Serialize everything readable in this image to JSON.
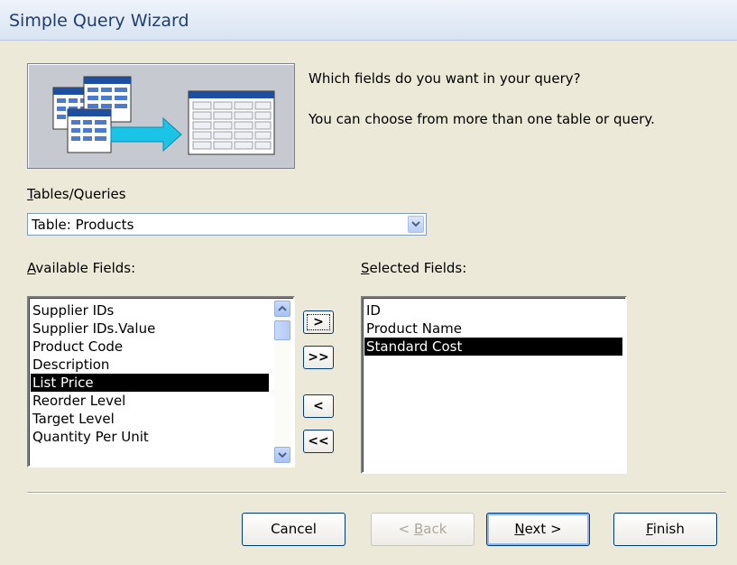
{
  "window": {
    "title": "Simple Query Wizard"
  },
  "prompt": {
    "line1": "Which fields do you want in your query?",
    "line2": "You can choose from more than one table or query."
  },
  "tables": {
    "label_first": "T",
    "label_rest": "ables/Queries",
    "selected": "Table: Products"
  },
  "available": {
    "label_first": "A",
    "label_rest": "vailable Fields:",
    "items": [
      "Supplier IDs",
      "Supplier IDs.Value",
      "Product Code",
      "Description",
      "List Price",
      "Reorder Level",
      "Target Level",
      "Quantity Per Unit"
    ],
    "selected_index": 4
  },
  "selected_fields": {
    "label_first": "S",
    "label_rest": "elected Fields:",
    "items": [
      "ID",
      "Product Name",
      "Standard Cost"
    ],
    "selected_index": 2
  },
  "move_buttons": {
    "add_one": ">",
    "add_all": ">>",
    "remove_one": "<",
    "remove_all": "<<"
  },
  "footer": {
    "cancel": "Cancel",
    "back_pre": "< ",
    "back_key": "B",
    "back_rest": "ack",
    "next_key": "N",
    "next_rest": "ext >",
    "finish_key": "F",
    "finish_rest": "inish"
  },
  "colors": {
    "selection": "#000000",
    "title_text": "#1f3f72",
    "dialog_bg": "#ece9d8"
  }
}
